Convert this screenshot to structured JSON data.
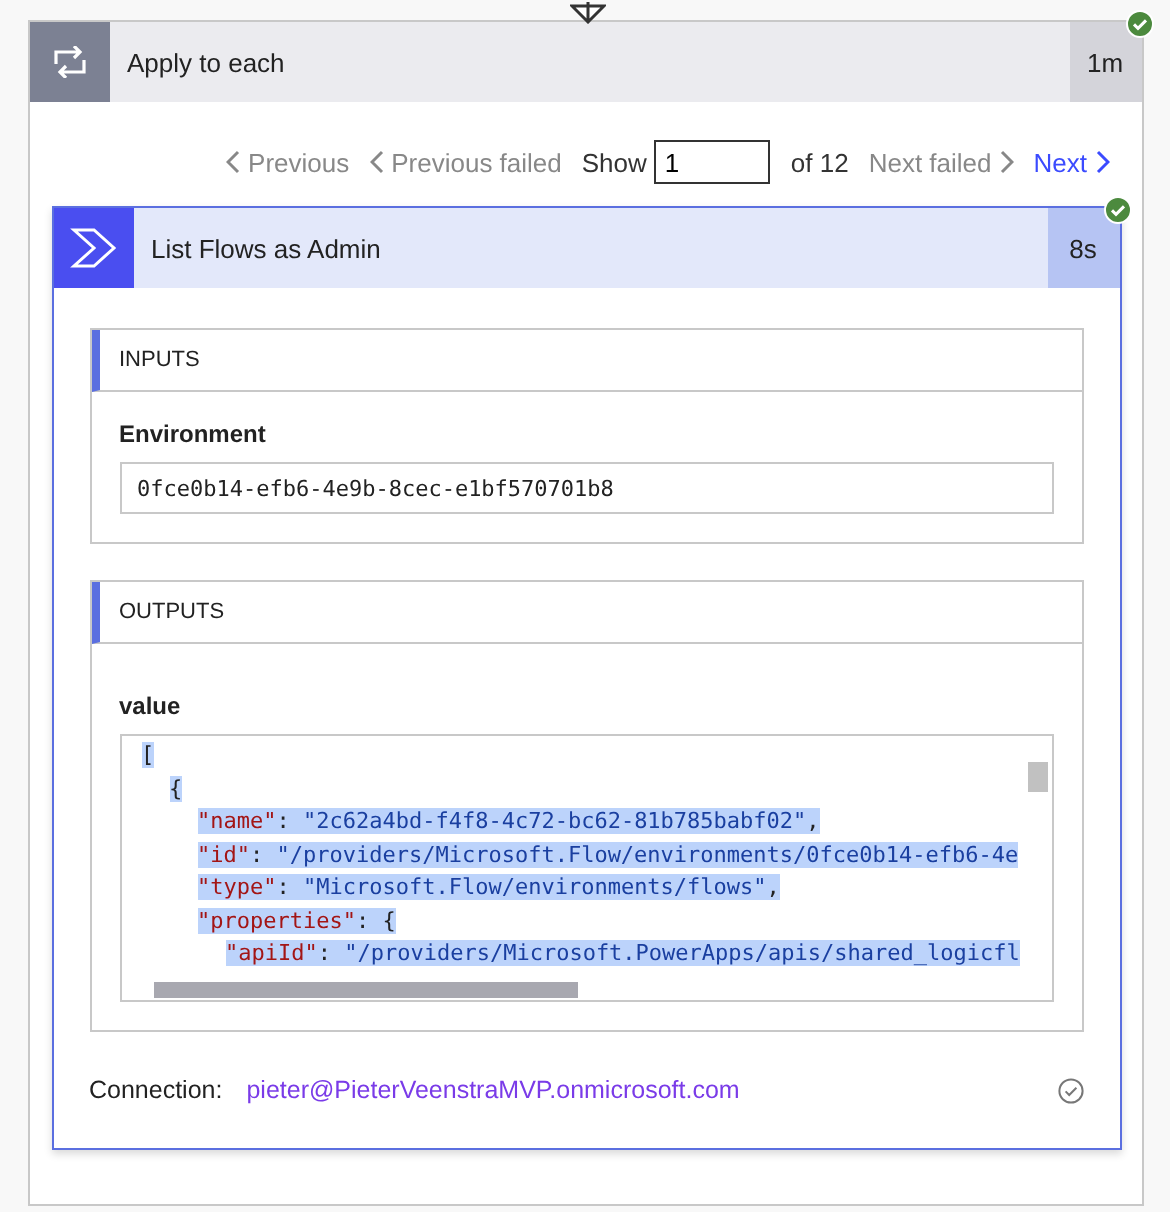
{
  "loop": {
    "title": "Apply to each",
    "duration": "1m",
    "succeeded": true
  },
  "pager": {
    "previous": "Previous",
    "previous_failed": "Previous failed",
    "show_label": "Show",
    "value": "1",
    "of": "of 12",
    "next_failed": "Next failed",
    "next": "Next"
  },
  "action": {
    "title": "List Flows as Admin",
    "duration": "8s",
    "succeeded": true
  },
  "inputs": {
    "heading": "INPUTS",
    "fields": [
      {
        "label": "Environment",
        "value": "0fce0b14-efb6-4e9b-8cec-e1bf570701b8"
      }
    ]
  },
  "outputs": {
    "heading": "OUTPUTS",
    "label": "value",
    "lines": [
      {
        "selected": true,
        "parts": [
          {
            "kind": "punct",
            "text": "["
          }
        ],
        "children": [
          {
            "selected": true,
            "parts": [
              {
                "kind": "punct",
                "text": "{"
              }
            ],
            "children": [
              {
                "selected": true,
                "parts": [
                  {
                    "kind": "key",
                    "text": "\"name\""
                  },
                  {
                    "kind": "punct",
                    "text": ":"
                  },
                  {
                    "kind": "string",
                    "text": "\"2c62a4bd-f4f8-4c72-bc62-81b785babf02\""
                  },
                  {
                    "kind": "punct",
                    "text": ","
                  }
                ]
              },
              {
                "selected": true,
                "parts": [
                  {
                    "kind": "key",
                    "text": "\"id\""
                  },
                  {
                    "kind": "punct",
                    "text": ":"
                  },
                  {
                    "kind": "string",
                    "text": "\"/providers/Microsoft.Flow/environments/0fce0b14-efb6-4e"
                  }
                ]
              },
              {
                "selected": true,
                "parts": [
                  {
                    "kind": "key",
                    "text": "\"type\""
                  },
                  {
                    "kind": "punct",
                    "text": ":"
                  },
                  {
                    "kind": "string",
                    "text": "\"Microsoft.Flow/environments/flows\""
                  },
                  {
                    "kind": "punct",
                    "text": ","
                  }
                ]
              },
              {
                "selected": true,
                "parts": [
                  {
                    "kind": "key",
                    "text": "\"properties\""
                  },
                  {
                    "kind": "punct",
                    "text": ":"
                  },
                  {
                    "kind": "punct",
                    "text": "{"
                  }
                ],
                "children": [
                  {
                    "selected": true,
                    "parts": [
                      {
                        "kind": "key",
                        "text": "\"apiId\""
                      },
                      {
                        "kind": "punct",
                        "text": ":"
                      },
                      {
                        "kind": "string",
                        "text": "\"/providers/Microsoft.PowerApps/apis/shared_logicfl"
                      }
                    ]
                  }
                ]
              }
            ]
          }
        ]
      }
    ]
  },
  "connection": {
    "label": "Connection:",
    "value": "pieter@PieterVeenstraMVP.onmicrosoft.com"
  }
}
